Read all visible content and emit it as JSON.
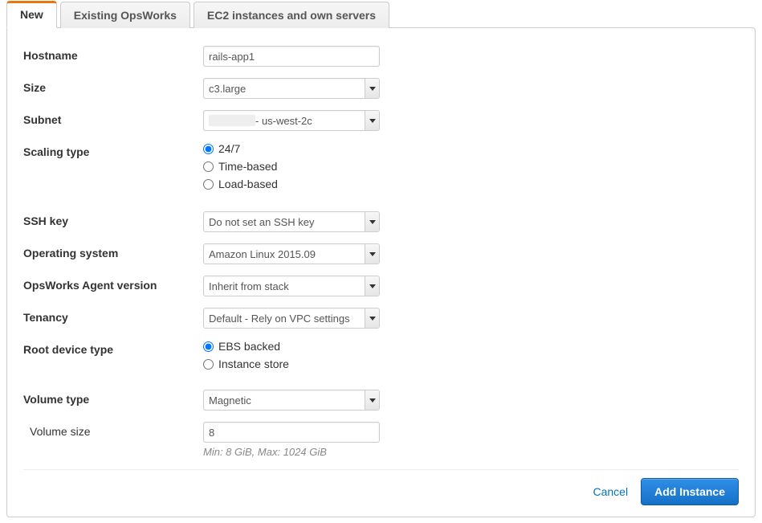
{
  "tabs": {
    "new": "New",
    "existing": "Existing OpsWorks",
    "ec2": "EC2 instances and own servers"
  },
  "labels": {
    "hostname": "Hostname",
    "size": "Size",
    "subnet": "Subnet",
    "scaling_type": "Scaling type",
    "ssh_key": "SSH key",
    "os": "Operating system",
    "agent": "OpsWorks Agent version",
    "tenancy": "Tenancy",
    "root_device": "Root device type",
    "volume_type": "Volume type",
    "volume_size": "Volume size"
  },
  "values": {
    "hostname": "rails-app1",
    "size": "c3.large",
    "subnet": " - us-west-2c",
    "ssh_key": "Do not set an SSH key",
    "os": "Amazon Linux 2015.09",
    "agent": "Inherit from stack",
    "tenancy": "Default - Rely on VPC settings",
    "volume_type": "Magnetic",
    "volume_size": "8"
  },
  "scaling_options": {
    "always": "24/7",
    "time": "Time-based",
    "load": "Load-based"
  },
  "root_device_options": {
    "ebs": "EBS backed",
    "instance_store": "Instance store"
  },
  "volume_hint": "Min: 8 GiB, Max: 1024 GiB",
  "actions": {
    "cancel": "Cancel",
    "add": "Add Instance"
  }
}
